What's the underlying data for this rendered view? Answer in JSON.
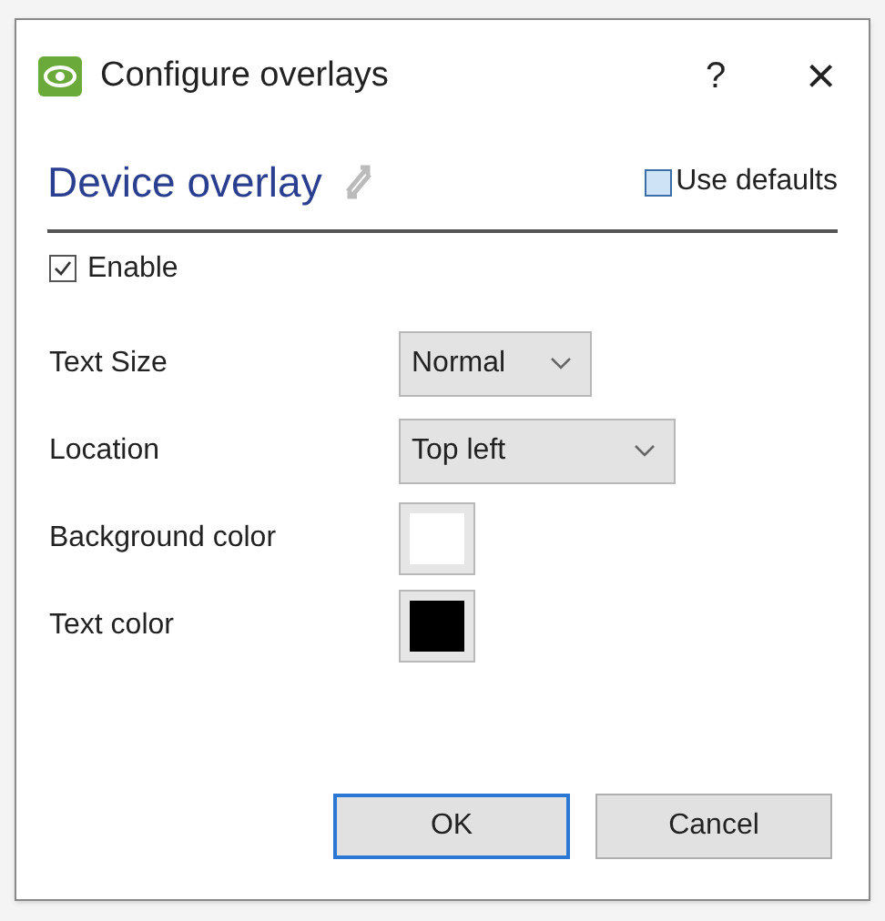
{
  "window": {
    "title": "Configure overlays",
    "help": "?",
    "close": "×"
  },
  "section": {
    "title": "Device overlay",
    "use_defaults": {
      "label": "Use defaults",
      "checked": false
    }
  },
  "enable": {
    "label": "Enable",
    "checked": true
  },
  "fields": [
    {
      "kind": "select",
      "label": "Text Size",
      "value": "Normal"
    },
    {
      "kind": "select",
      "label": "Location",
      "value": "Top left"
    },
    {
      "kind": "color",
      "label": "Background color",
      "color": "#ffffff"
    },
    {
      "kind": "color",
      "label": "Text color",
      "color": "#000000"
    }
  ],
  "buttons": [
    {
      "label": "OK",
      "default": true
    },
    {
      "label": "Cancel",
      "default": false
    }
  ]
}
